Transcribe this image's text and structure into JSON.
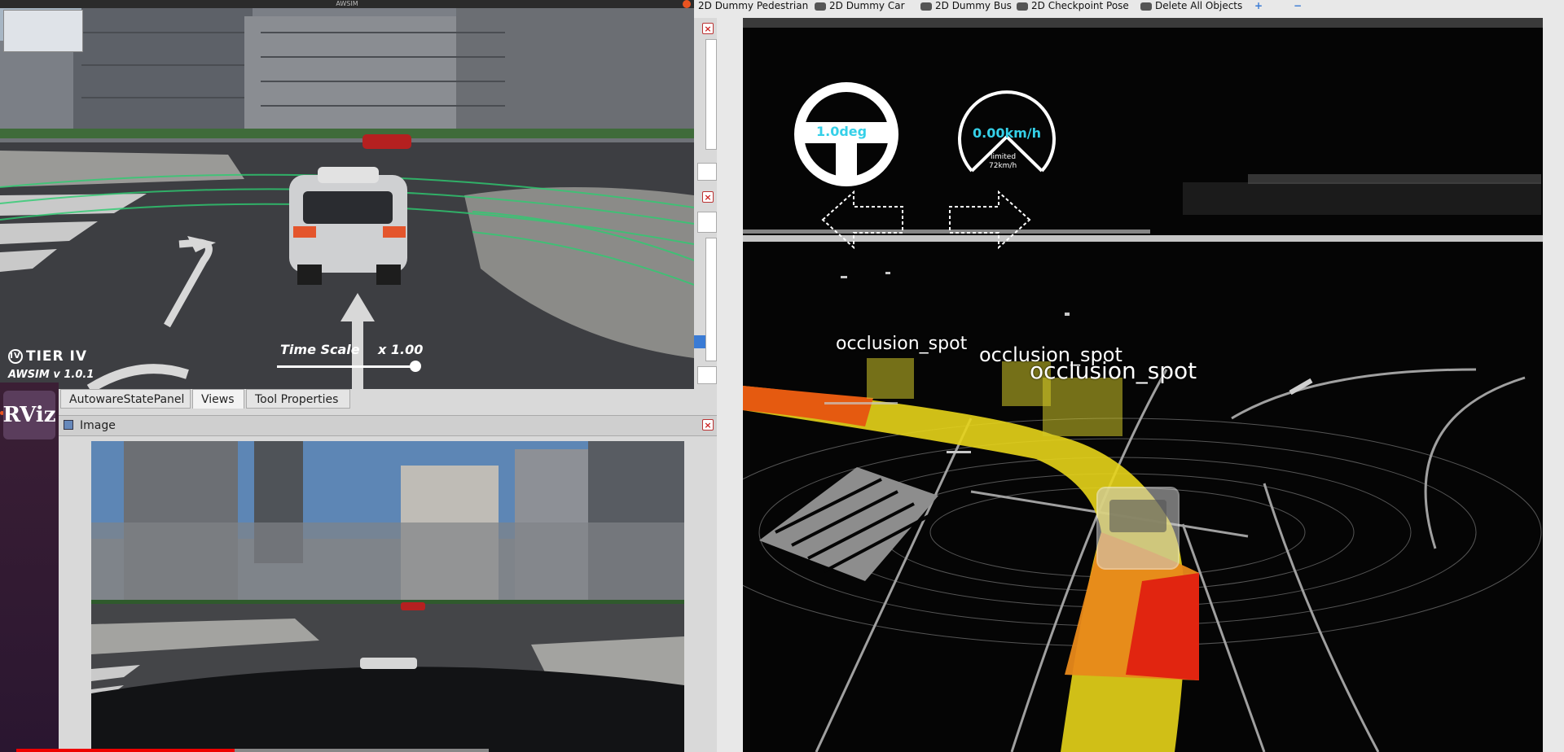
{
  "awsim": {
    "window_title": "AWSIM",
    "brand": "TIER IV",
    "version": "AWSIM  v 1.0.1",
    "time_scale_label": "Time Scale",
    "time_scale_value": "x 1.00",
    "time_scale_fraction": 1.0
  },
  "launcher": {
    "rviz_label": "RViz"
  },
  "toolbar": {
    "items": [
      "2D Dummy Pedestrian",
      "2D Dummy Car",
      "2D Dummy Bus",
      "2D Checkpoint Pose",
      "Delete All Objects"
    ],
    "plus": "+",
    "minus": "−"
  },
  "tabs": [
    "AutowareStatePanel",
    "Views",
    "Tool Properties"
  ],
  "active_tab": "Views",
  "image_panel": {
    "title": "Image"
  },
  "hud": {
    "steering_value": "1.0deg",
    "speed_value": "0.00km/h",
    "speed_limit_label": "limited",
    "speed_limit_value": "72km/h"
  },
  "occlusion_labels": [
    "occlusion_spot",
    "occlusion_spot",
    "occlusion_spot"
  ],
  "colors": {
    "accent_cyan": "#35d0e8",
    "occlusion": "#d2c828",
    "path_yellow": "#f5e21a",
    "path_red": "#e02010",
    "close_red": "#cc2222"
  }
}
